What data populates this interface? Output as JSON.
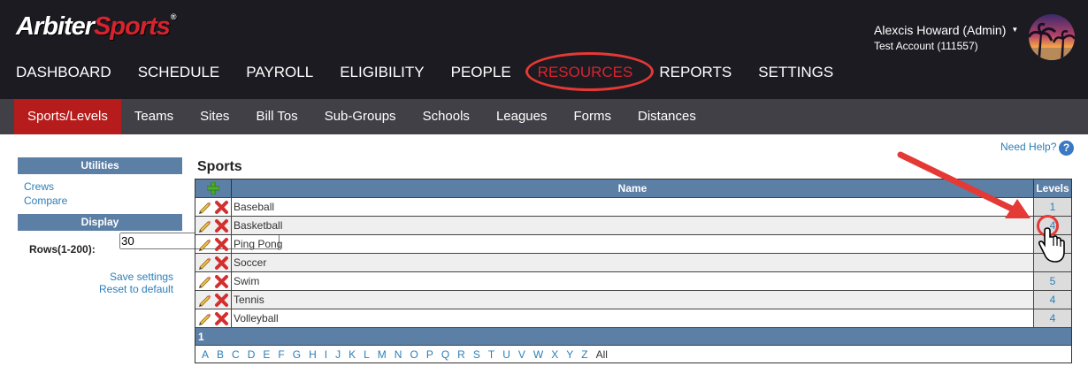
{
  "header": {
    "logo_white": "Arbiter",
    "logo_red": "Sports",
    "logo_tm": "®",
    "user_name": "Alexcis Howard (Admin)",
    "user_caret": "▼",
    "account": "Test Account (111557)"
  },
  "main_nav": [
    {
      "label": "DASHBOARD"
    },
    {
      "label": "SCHEDULE"
    },
    {
      "label": "PAYROLL"
    },
    {
      "label": "ELIGIBILITY"
    },
    {
      "label": "PEOPLE"
    },
    {
      "label": "RESOURCES"
    },
    {
      "label": "REPORTS"
    },
    {
      "label": "SETTINGS"
    }
  ],
  "sub_nav": [
    {
      "label": "Sports/Levels"
    },
    {
      "label": "Teams"
    },
    {
      "label": "Sites"
    },
    {
      "label": "Bill Tos"
    },
    {
      "label": "Sub-Groups"
    },
    {
      "label": "Schools"
    },
    {
      "label": "Leagues"
    },
    {
      "label": "Forms"
    },
    {
      "label": "Distances"
    }
  ],
  "sidebar": {
    "utilities_title": "Utilities",
    "crews": "Crews",
    "compare": "Compare",
    "display_title": "Display",
    "rows_label": "Rows(1-200):",
    "rows_value": "30",
    "save_settings": "Save settings",
    "reset_default": "Reset to default"
  },
  "help": {
    "label": "Need Help?",
    "icon": "?"
  },
  "sports": {
    "title": "Sports",
    "col_name": "Name",
    "col_levels": "Levels",
    "rows": [
      {
        "name": "Baseball",
        "levels": "1"
      },
      {
        "name": "Basketball",
        "levels": "4"
      },
      {
        "name": "Ping Pong",
        "levels": ""
      },
      {
        "name": "Soccer",
        "levels": ""
      },
      {
        "name": "Swim",
        "levels": "5"
      },
      {
        "name": "Tennis",
        "levels": "4"
      },
      {
        "name": "Volleyball",
        "levels": "4"
      }
    ],
    "page": "1",
    "letters": [
      "A",
      "B",
      "C",
      "D",
      "E",
      "F",
      "G",
      "H",
      "I",
      "J",
      "K",
      "L",
      "M",
      "N",
      "O",
      "P",
      "Q",
      "R",
      "S",
      "T",
      "U",
      "V",
      "W",
      "X",
      "Y",
      "Z"
    ],
    "all_label": "All"
  },
  "colors": {
    "header_bg": "#1c1b22",
    "subnav_bg": "#414046",
    "active_red": "#b71c1c",
    "grid_header": "#5b7fa5",
    "link_blue": "#2c7fb8",
    "annotation_red": "#e53935"
  }
}
